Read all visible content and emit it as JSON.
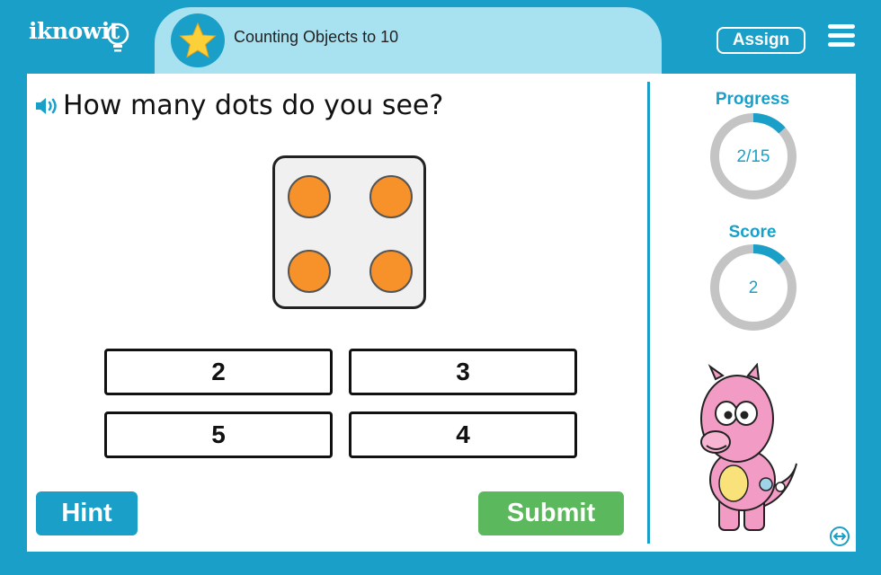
{
  "header": {
    "logo": "iknowit",
    "lesson_title": "Counting Objects to 10",
    "assign_label": "Assign",
    "icons": {
      "star": "star-icon",
      "menu": "hamburger-menu-icon"
    }
  },
  "question": {
    "text": "How many dots do you see?",
    "speaker_icon": "speaker-icon",
    "dots_shown": 4
  },
  "answers": [
    "2",
    "3",
    "5",
    "4"
  ],
  "buttons": {
    "hint": "Hint",
    "submit": "Submit"
  },
  "sidebar": {
    "progress_label": "Progress",
    "progress_value": "2/15",
    "progress_fraction": 0.133,
    "score_label": "Score",
    "score_value": "2",
    "score_fraction": 0.133
  },
  "colors": {
    "brand": "#1aa0c8",
    "title_bg": "#a8e1f0",
    "dot": "#f7922a",
    "submit": "#5cb85c",
    "ring_track": "#c4c4c4"
  }
}
